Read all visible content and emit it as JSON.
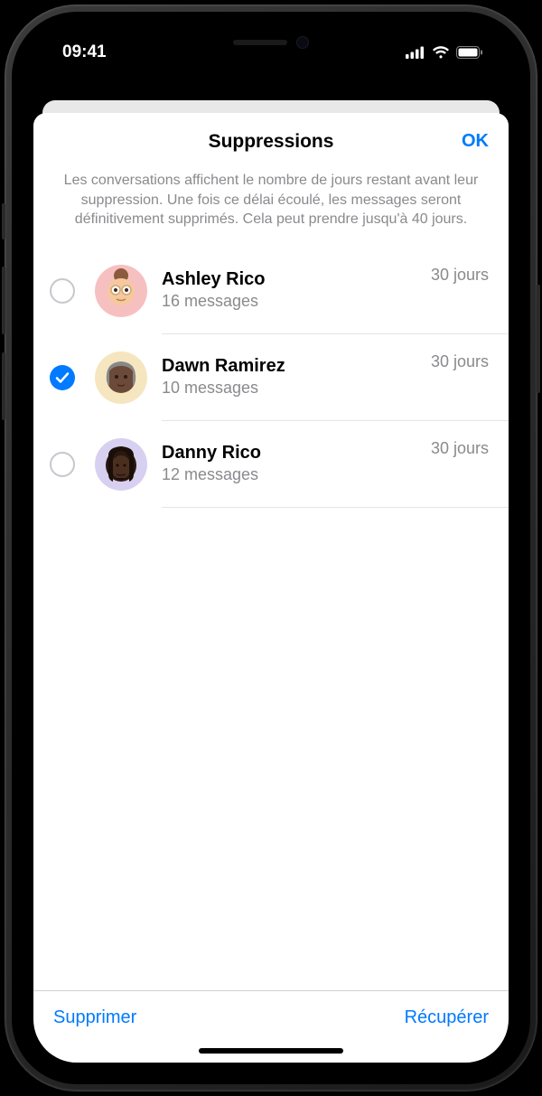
{
  "status": {
    "time": "09:41"
  },
  "sheet": {
    "title": "Suppressions",
    "done": "OK",
    "description": "Les conversations affichent le nombre de jours restant avant leur suppression. Une fois ce délai écoulé, les messages seront définitivement supprimés. Cela peut prendre jusqu'à 40 jours."
  },
  "conversations": [
    {
      "name": "Ashley Rico",
      "subtitle": "16 messages",
      "days": "30 jours",
      "selected": false,
      "avatar_bg": "#f7c0c0"
    },
    {
      "name": "Dawn Ramirez",
      "subtitle": "10 messages",
      "days": "30 jours",
      "selected": true,
      "avatar_bg": "#f5e6c0"
    },
    {
      "name": "Danny Rico",
      "subtitle": "12 messages",
      "days": "30 jours",
      "selected": false,
      "avatar_bg": "#d8d0f0"
    }
  ],
  "toolbar": {
    "delete": "Supprimer",
    "recover": "Récupérer"
  }
}
